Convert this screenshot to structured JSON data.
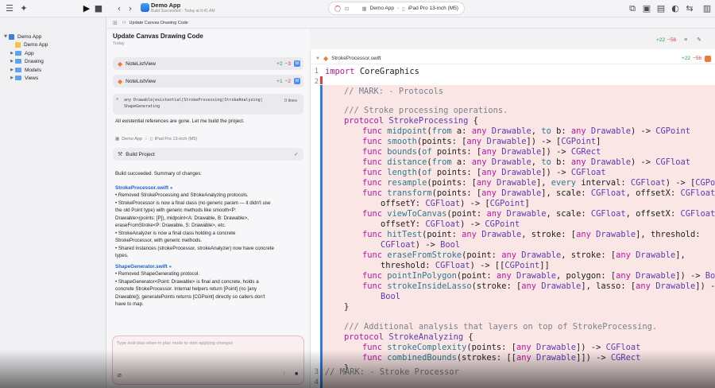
{
  "toolbar": {
    "app_name": "Demo App",
    "build_status": "Build Succeeded · Today at 9:41 AM",
    "scheme": "Demo App",
    "destination": "iPad Pro 13-inch (M5)",
    "breadcrumb": "Update Canvas Drawing Code"
  },
  "navigator": {
    "project": "Demo App",
    "target": "Demo App",
    "folders": [
      "App",
      "Drawing",
      "Models",
      "Views"
    ]
  },
  "chat": {
    "title": "Update Canvas Drawing Code",
    "date": "Today",
    "diff_add": "+22",
    "diff_del": "−56",
    "files": [
      {
        "name": "NoteListView",
        "add": "+2",
        "del": "−3",
        "badge": "M"
      },
      {
        "name": "NoteListView",
        "add": "+1",
        "del": "−2",
        "badge": "M"
      }
    ],
    "search": {
      "query_line1": "any Drawable|existential|StrokeProcessing|StrokeAnalyzing|",
      "query_line2": "ShapeGenerating",
      "result": "0 lines"
    },
    "msg_existential": "All existential references are gone. Let me build the project.",
    "build_scheme": "Demo App",
    "build_dest": "iPad Pro 13-inch (M5)",
    "build_label": "Build Project",
    "summary_intro": "Build succeeded. Summary of changes:",
    "file1": "StrokeProcessor.swift",
    "file1_lines": [
      "• Removed StrokeProcessing and StrokeAnalyzing protocols.",
      "• StrokeProcessor is now a final class (no generic param — it didn't use",
      "the old Point type) with generic methods like smooth<P:",
      "Drawable>(points: [P]), midpoint<A: Drawable, B: Drawable>,",
      "eraseFromStroke<P: Drawable, S: Drawable>, etc.",
      "• StrokeAnalyzer is now a final class holding a concrete",
      "StrokeProcessor, with generic methods.",
      "• Shared instances (strokeProcessor, strokeAnalyzer) now have concrete",
      "types."
    ],
    "file2": "ShapeGenerator.swift",
    "file2_lines": [
      "• Removed ShapeGenerating protocol.",
      "• ShapeGenerator<Point: Drawable> is final and concrete, holds a",
      "concrete StrokeProcessor. Internal helpers return [Point] (no [any",
      "Drawable]); generatePoints returns [CGPoint] directly so callers don't",
      "have to map."
    ],
    "composer_placeholder": "Type /exit-plan when in plan mode to start applying changes"
  },
  "editor": {
    "filename": "StrokeProcessor.swift",
    "diff_add": "+22",
    "diff_del": "−56",
    "line_numbers": [
      "1",
      "2",
      "3",
      "4"
    ]
  },
  "colors": {
    "keyword": "#b8189d",
    "type": "#5b3bb2",
    "function": "#2a7a8a",
    "comment": "#7b828a",
    "accent": "#2f7ee5",
    "deleted_bg": "#fbe6e6"
  }
}
